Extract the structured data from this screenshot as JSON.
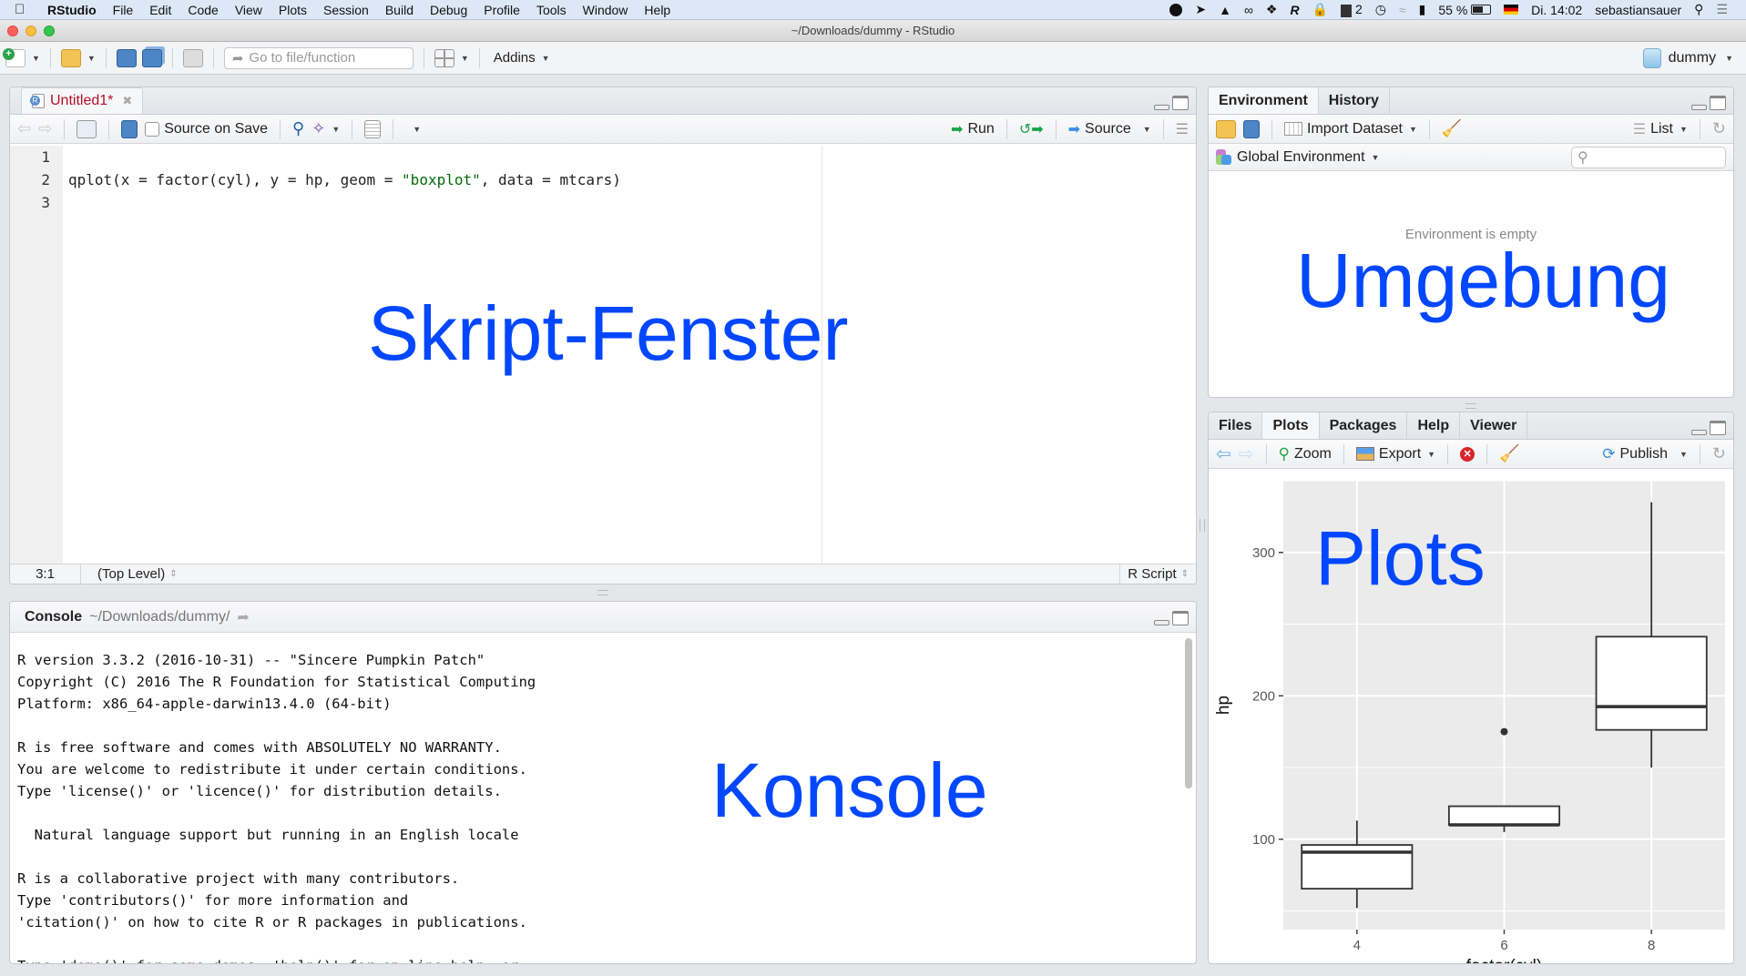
{
  "menubar": {
    "app_name": "RStudio",
    "items": [
      "File",
      "Edit",
      "Code",
      "View",
      "Plots",
      "Session",
      "Build",
      "Debug",
      "Profile",
      "Tools",
      "Window",
      "Help"
    ],
    "status": {
      "badge_count": "2",
      "battery": "55 %",
      "clock": "Di. 14:02",
      "user": "sebastiansauer"
    }
  },
  "window": {
    "title": "~/Downloads/dummy - RStudio"
  },
  "toolbar": {
    "goto_placeholder": "Go to file/function",
    "addins_label": "Addins",
    "project_label": "dummy"
  },
  "editor": {
    "tab_label": "Untitled1*",
    "source_on_save_label": "Source on Save",
    "source_on_save_checked": false,
    "run_label": "Run",
    "source_label": "Source",
    "line_numbers": [
      "1",
      "2",
      "3"
    ],
    "code_lines": [
      {
        "pre": "",
        "str": "",
        "post": ""
      },
      {
        "pre": "qplot(x = factor(cyl), y = hp, geom = ",
        "str": "\"boxplot\"",
        "post": ", data = mtcars)"
      },
      {
        "pre": "",
        "str": "",
        "post": ""
      }
    ],
    "cursor_position": "3:1",
    "scope": "(Top Level)",
    "file_type": "R Script",
    "overlay_label": "Skript-Fenster"
  },
  "console": {
    "title": "Console",
    "path": "~/Downloads/dummy/",
    "output": "R version 3.3.2 (2016-10-31) -- \"Sincere Pumpkin Patch\"\nCopyright (C) 2016 The R Foundation for Statistical Computing\nPlatform: x86_64-apple-darwin13.4.0 (64-bit)\n\nR is free software and comes with ABSOLUTELY NO WARRANTY.\nYou are welcome to redistribute it under certain conditions.\nType 'license()' or 'licence()' for distribution details.\n\n  Natural language support but running in an English locale\n\nR is a collaborative project with many contributors.\nType 'contributors()' for more information and\n'citation()' on how to cite R or R packages in publications.\n\nType 'demo()' for some demos, 'help()' for on-line help, or",
    "overlay_label": "Konsole"
  },
  "environment_pane": {
    "tabs": [
      "Environment",
      "History"
    ],
    "active_tab": "Environment",
    "import_dataset_label": "Import Dataset",
    "view_mode_label": "List",
    "scope_label": "Global Environment",
    "empty_message": "Environment is empty",
    "overlay_label": "Umgebung"
  },
  "plots_pane": {
    "tabs": [
      "Files",
      "Plots",
      "Packages",
      "Help",
      "Viewer"
    ],
    "active_tab": "Plots",
    "zoom_label": "Zoom",
    "export_label": "Export",
    "publish_label": "Publish",
    "overlay_label": "Plots"
  },
  "chart_data": {
    "type": "boxplot",
    "title": "",
    "xlabel": "factor(cyl)",
    "ylabel": "hp",
    "categories": [
      "4",
      "6",
      "8"
    ],
    "boxes": [
      {
        "category": "4",
        "min": 52,
        "q1": 65.5,
        "median": 91,
        "q3": 96,
        "max": 113,
        "outliers": []
      },
      {
        "category": "6",
        "min": 105,
        "q1": 110,
        "median": 110,
        "q3": 123,
        "max": 123,
        "outliers": [
          175
        ]
      },
      {
        "category": "8",
        "min": 150,
        "q1": 176.25,
        "median": 192.5,
        "q3": 241.25,
        "max": 335,
        "outliers": []
      }
    ],
    "yticks": [
      100,
      200,
      300
    ],
    "ylim": [
      37,
      350
    ],
    "grid": true,
    "panel_background": "#ebebeb",
    "box_fill": "#ffffff",
    "line_color": "#333333"
  },
  "colors": {
    "overlay_text": "#0047ff",
    "tab_modified": "#b5102a",
    "string_literal": "#036a07"
  }
}
